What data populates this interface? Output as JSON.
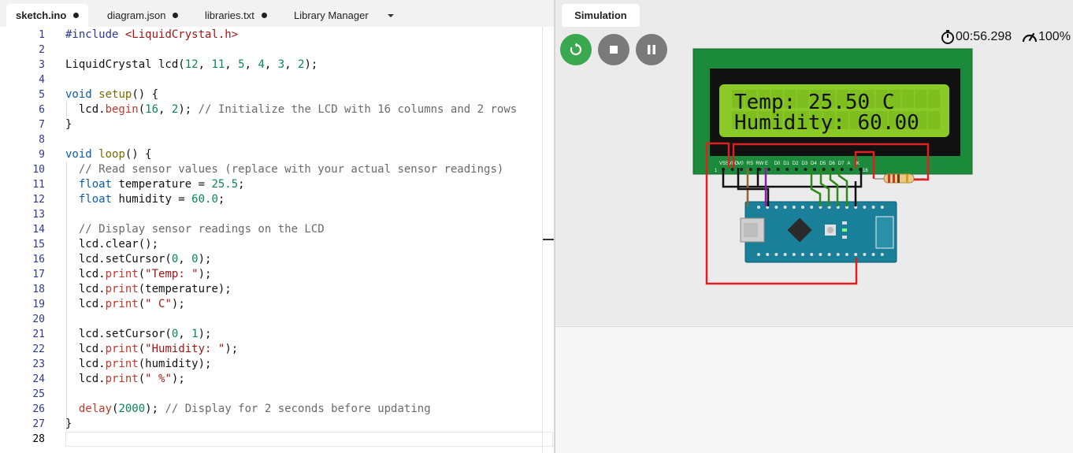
{
  "tabs": [
    {
      "label": "sketch.ino",
      "modified": true,
      "active": true
    },
    {
      "label": "diagram.json",
      "modified": true,
      "active": false
    },
    {
      "label": "libraries.txt",
      "modified": true,
      "active": false
    },
    {
      "label": "Library Manager",
      "modified": false,
      "active": false
    }
  ],
  "editor": {
    "line_numbers": [
      "1",
      "2",
      "3",
      "4",
      "5",
      "6",
      "7",
      "8",
      "9",
      "10",
      "11",
      "12",
      "13",
      "14",
      "15",
      "16",
      "17",
      "18",
      "19",
      "20",
      "21",
      "22",
      "23",
      "24",
      "25",
      "26",
      "27",
      "28"
    ],
    "lines": [
      "#include <LiquidCrystal.h>",
      "",
      "LiquidCrystal lcd(12, 11, 5, 4, 3, 2);",
      "",
      "void setup() {",
      "  lcd.begin(16, 2); // Initialize the LCD with 16 columns and 2 rows",
      "}",
      "",
      "void loop() {",
      "  // Read sensor values (replace with your actual sensor readings)",
      "  float temperature = 25.5;",
      "  float humidity = 60.0;",
      "",
      "  // Display sensor readings on the LCD",
      "  lcd.clear();",
      "  lcd.setCursor(0, 0);",
      "  lcd.print(\"Temp: \");",
      "  lcd.print(temperature);",
      "  lcd.print(\" C\");",
      "",
      "  lcd.setCursor(0, 1);",
      "  lcd.print(\"Humidity: \");",
      "  lcd.print(humidity);",
      "  lcd.print(\" %\");",
      "",
      "  delay(2000); // Display for 2 seconds before updating",
      "}",
      ""
    ]
  },
  "simulation": {
    "tab_label": "Simulation",
    "elapsed_time": "00:56.298",
    "speed": "100%",
    "controls": [
      "restart",
      "stop",
      "pause"
    ],
    "lcd": {
      "line1": "Temp: 25.50 C",
      "line2": "Humidity: 60.00",
      "pin_labels": [
        "VSS",
        "VDD",
        "V0",
        "RS",
        "RW",
        "E",
        "D0",
        "D1",
        "D2",
        "D3",
        "D4",
        "D5",
        "D6",
        "D7",
        "A",
        "K"
      ],
      "pin_first": "1",
      "pin_last": "16"
    }
  },
  "colors": {
    "restart": "#3aa84f",
    "control_gray": "#7a7a7a",
    "lcd_screen": "#8ac926",
    "pcb_green": "#1b8a3a",
    "arduino": "#1a7f98",
    "wire_red": "#e02020",
    "wire_black": "#111111",
    "wire_green": "#2d8a17",
    "wire_purple": "#8a1ea8",
    "wire_brown": "#8b6a2f"
  }
}
